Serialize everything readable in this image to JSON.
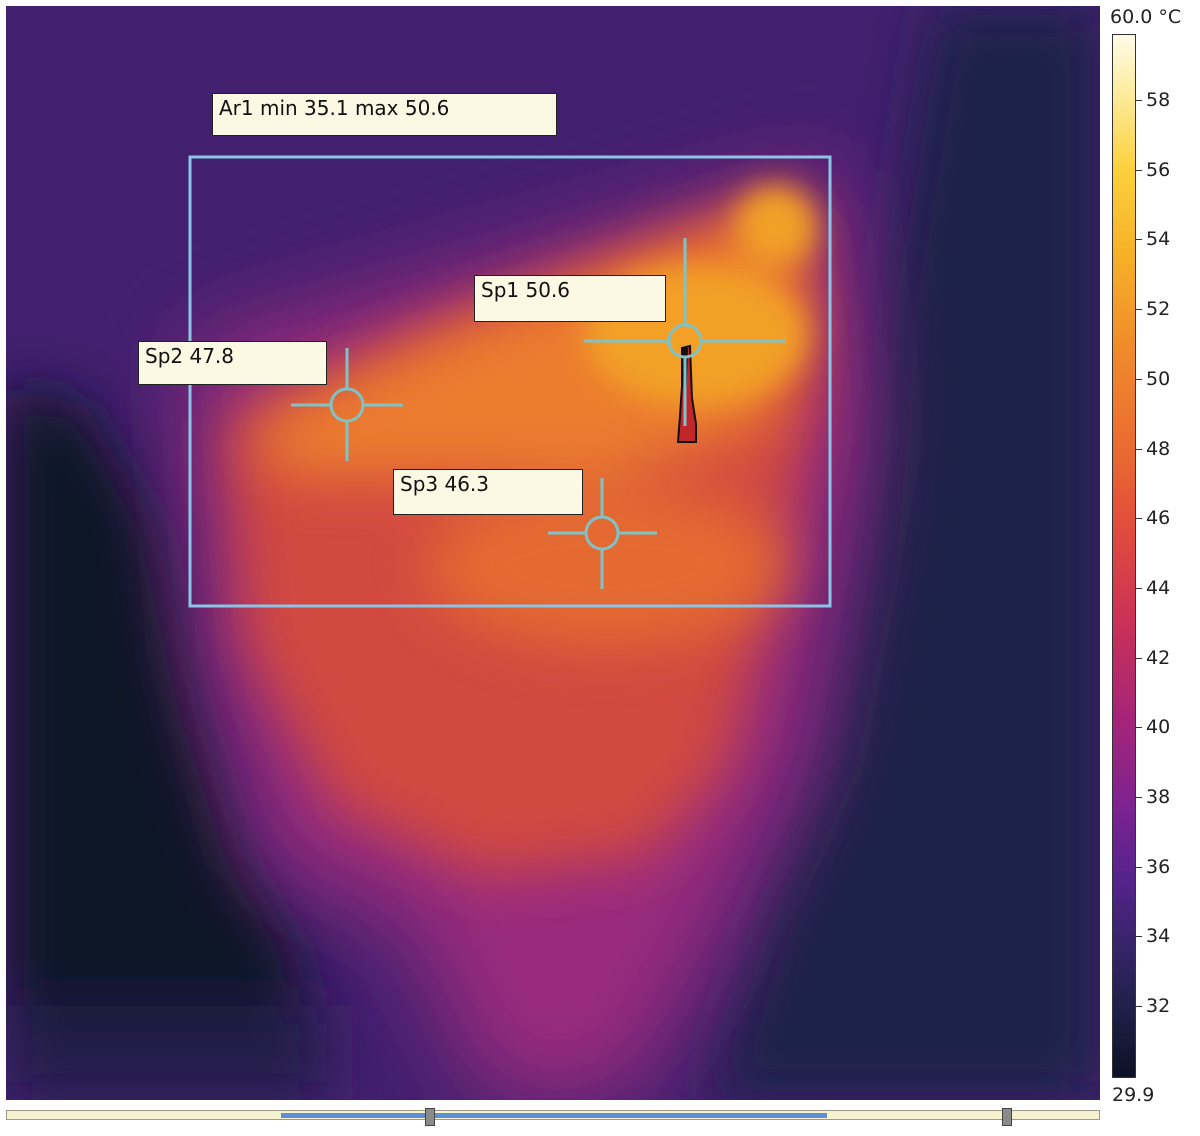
{
  "measurements": {
    "area": {
      "label": "Ar1 min 35.1 max 50.6"
    },
    "spots": [
      {
        "id": "sp1",
        "label": "Sp1 50.6"
      },
      {
        "id": "sp2",
        "label": "Sp2 47.8"
      },
      {
        "id": "sp3",
        "label": "Sp3 46.3"
      }
    ]
  },
  "scale": {
    "max_label": "60.0 °C",
    "min_label": "29.9",
    "ticks": [
      "58",
      "56",
      "54",
      "52",
      "50",
      "48",
      "46",
      "44",
      "42",
      "40",
      "38",
      "36",
      "34",
      "32"
    ],
    "palette": "iron"
  },
  "colors": {
    "marker": "#7fc3c8",
    "area_box": "#8cc4e8",
    "label_bg": "#fbf9e4"
  }
}
